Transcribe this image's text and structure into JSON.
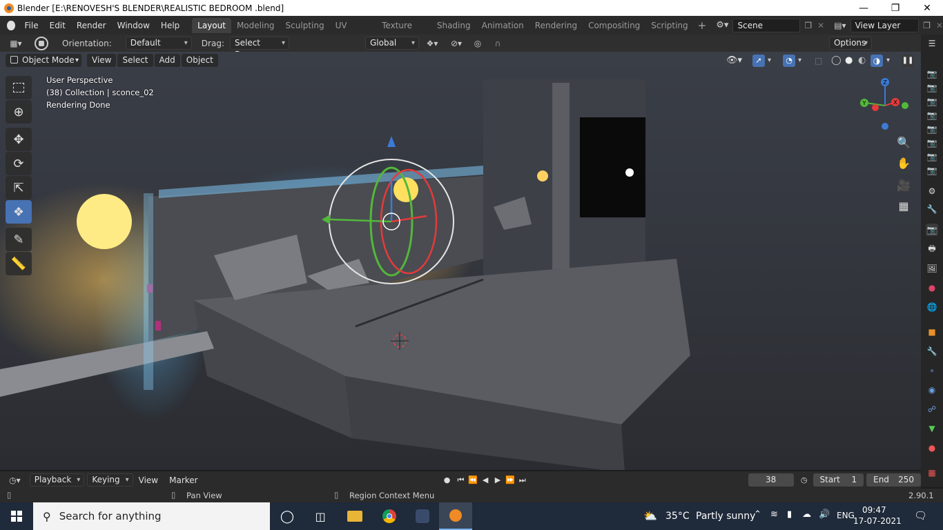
{
  "window": {
    "title": "Blender [E:\\RENOVESH'S BLENDER\\REALISTIC BEDROOM .blend]"
  },
  "menubar": {
    "items": [
      "File",
      "Edit",
      "Render",
      "Window",
      "Help"
    ]
  },
  "workspaces": {
    "tabs": [
      "Layout",
      "Modeling",
      "Sculpting",
      "UV Editing",
      "Texture Paint",
      "Shading",
      "Animation",
      "Rendering",
      "Compositing",
      "Scripting"
    ],
    "active": "Layout"
  },
  "scene": {
    "name": "Scene"
  },
  "view_layer": {
    "name": "View Layer"
  },
  "tool_header": {
    "orientation_label": "Orientation:",
    "orientation_value": "Default",
    "drag_label": "Drag:",
    "drag_value": "Select Box",
    "transform_orientation": "Global",
    "options_label": "Options"
  },
  "viewport_header": {
    "mode": "Object Mode",
    "menus": [
      "View",
      "Select",
      "Add",
      "Object"
    ]
  },
  "viewport_overlay": {
    "line1": "User Perspective",
    "line2": "(38) Collection | sconce_02",
    "line3": "Rendering Done"
  },
  "gizmo_axes": {
    "x": "X",
    "y": "Y",
    "z": "Z"
  },
  "timeline": {
    "menus": [
      "Playback",
      "Keying",
      "View",
      "Marker"
    ],
    "current_frame": "38",
    "start_label": "Start",
    "start_value": "1",
    "end_label": "End",
    "end_value": "250"
  },
  "statusbar": {
    "left_hint": "Pan View",
    "right_hint": "Region Context Menu",
    "version": "2.90.1"
  },
  "taskbar": {
    "search_placeholder": "Search for anything",
    "weather_temp": "35°C",
    "weather_desc": "Partly sunny",
    "language": "ENG",
    "time": "09:47",
    "date": "17-07-2021"
  },
  "colors": {
    "accent": "#4772b3",
    "active_tab": "#404040",
    "header_bg": "#2b2b2b",
    "taskbar_bg": "#1f2a3a"
  }
}
